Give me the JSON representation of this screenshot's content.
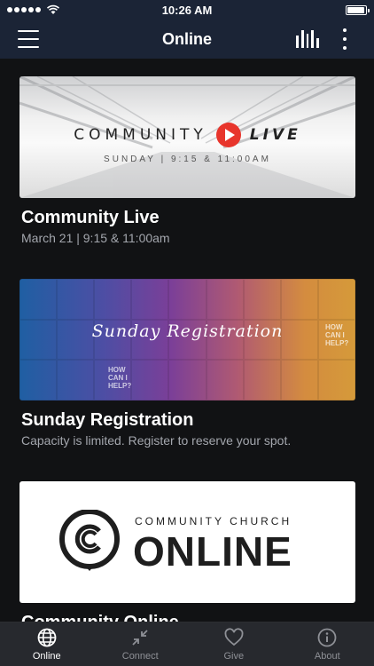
{
  "status_bar": {
    "time": "10:26 AM",
    "battery_level": 0.95,
    "signal_bars": 5
  },
  "nav": {
    "title": "Online"
  },
  "cards": [
    {
      "title": "Community Live",
      "subtitle": "March 21 | 9:15 & 11:00am",
      "image": {
        "word1": "COMMUNITY",
        "word2": "LIVE",
        "times": "SUNDAY | 9:15 & 11:00AM",
        "accent": "#e8352c"
      }
    },
    {
      "title": "Sunday Registration",
      "subtitle": "Capacity is limited. Register to reserve your spot.",
      "image": {
        "script_text": "Sunday Registration",
        "tag1": "HOW CAN I HELP?",
        "tag2": "HOW CAN I HELP?"
      }
    },
    {
      "title": "Community Online",
      "subtitle": "",
      "image": {
        "church_text": "COMMUNITY CHURCH",
        "online_text": "ONLINE"
      }
    }
  ],
  "tabs": [
    {
      "label": "Online",
      "icon": "globe-icon",
      "active": true
    },
    {
      "label": "Connect",
      "icon": "connect-icon",
      "active": false
    },
    {
      "label": "Give",
      "icon": "heart-icon",
      "active": false
    },
    {
      "label": "About",
      "icon": "info-icon",
      "active": false
    }
  ],
  "colors": {
    "nav_bg": "#1b2436",
    "page_bg": "#111214",
    "tab_bg": "#28292e",
    "subtitle": "#a3a6ad"
  }
}
